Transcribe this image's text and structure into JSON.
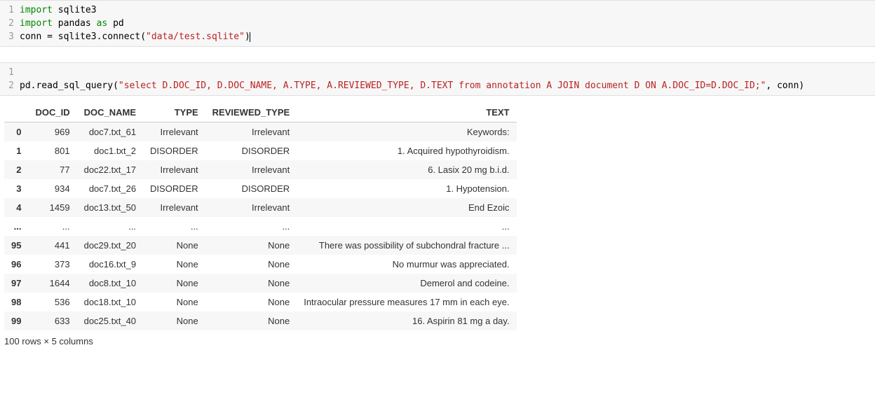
{
  "cell1": {
    "lines": [
      {
        "n": "1",
        "tokens": [
          {
            "t": "import ",
            "c": "k-import"
          },
          {
            "t": "sqlite3",
            "c": "ident"
          }
        ]
      },
      {
        "n": "2",
        "tokens": [
          {
            "t": "import ",
            "c": "k-import"
          },
          {
            "t": "pandas ",
            "c": "ident"
          },
          {
            "t": "as ",
            "c": "k-as"
          },
          {
            "t": "pd",
            "c": "ident"
          }
        ]
      },
      {
        "n": "3",
        "tokens": [
          {
            "t": "conn ",
            "c": "ident"
          },
          {
            "t": "= ",
            "c": "ident"
          },
          {
            "t": "sqlite3",
            "c": "ident"
          },
          {
            "t": ".",
            "c": "ident"
          },
          {
            "t": "connect",
            "c": "ident"
          },
          {
            "t": "(",
            "c": "paren"
          },
          {
            "t": "\"data/test.sqlite\"",
            "c": "str"
          },
          {
            "t": ")",
            "c": "paren"
          }
        ],
        "cursor": true
      }
    ]
  },
  "cell2": {
    "lines": [
      {
        "n": "1",
        "tokens": []
      },
      {
        "n": "2",
        "tokens": [
          {
            "t": "pd",
            "c": "ident"
          },
          {
            "t": ".",
            "c": "ident"
          },
          {
            "t": "read_sql_query",
            "c": "ident"
          },
          {
            "t": "(",
            "c": "paren"
          },
          {
            "t": "\"select D.DOC_ID, D.DOC_NAME, A.TYPE, A.REVIEWED_TYPE, D.TEXT from annotation A JOIN document D ON A.DOC_ID=D.DOC_ID;\"",
            "c": "str"
          },
          {
            "t": ", conn",
            "c": "ident"
          },
          {
            "t": ")",
            "c": "paren"
          }
        ]
      }
    ]
  },
  "df": {
    "columns": [
      "DOC_ID",
      "DOC_NAME",
      "TYPE",
      "REVIEWED_TYPE",
      "TEXT"
    ],
    "rows": [
      {
        "idx": "0",
        "cells": [
          "969",
          "doc7.txt_61",
          "Irrelevant",
          "Irrelevant",
          "Keywords:"
        ]
      },
      {
        "idx": "1",
        "cells": [
          "801",
          "doc1.txt_2",
          "DISORDER",
          "DISORDER",
          "1. Acquired hypothyroidism."
        ]
      },
      {
        "idx": "2",
        "cells": [
          "77",
          "doc22.txt_17",
          "Irrelevant",
          "Irrelevant",
          "6. Lasix 20 mg b.i.d."
        ]
      },
      {
        "idx": "3",
        "cells": [
          "934",
          "doc7.txt_26",
          "DISORDER",
          "DISORDER",
          "1. Hypotension."
        ]
      },
      {
        "idx": "4",
        "cells": [
          "1459",
          "doc13.txt_50",
          "Irrelevant",
          "Irrelevant",
          "End Ezoic"
        ]
      },
      {
        "idx": "...",
        "cells": [
          "...",
          "...",
          "...",
          "...",
          "..."
        ]
      },
      {
        "idx": "95",
        "cells": [
          "441",
          "doc29.txt_20",
          "None",
          "None",
          "There was possibility of subchondral fracture ..."
        ]
      },
      {
        "idx": "96",
        "cells": [
          "373",
          "doc16.txt_9",
          "None",
          "None",
          "No murmur was appreciated."
        ]
      },
      {
        "idx": "97",
        "cells": [
          "1644",
          "doc8.txt_10",
          "None",
          "None",
          "Demerol and codeine."
        ]
      },
      {
        "idx": "98",
        "cells": [
          "536",
          "doc18.txt_10",
          "None",
          "None",
          "Intraocular pressure measures 17 mm in each eye."
        ]
      },
      {
        "idx": "99",
        "cells": [
          "633",
          "doc25.txt_40",
          "None",
          "None",
          "16. Aspirin 81 mg a day."
        ]
      }
    ],
    "shape_text": "100 rows × 5 columns"
  }
}
